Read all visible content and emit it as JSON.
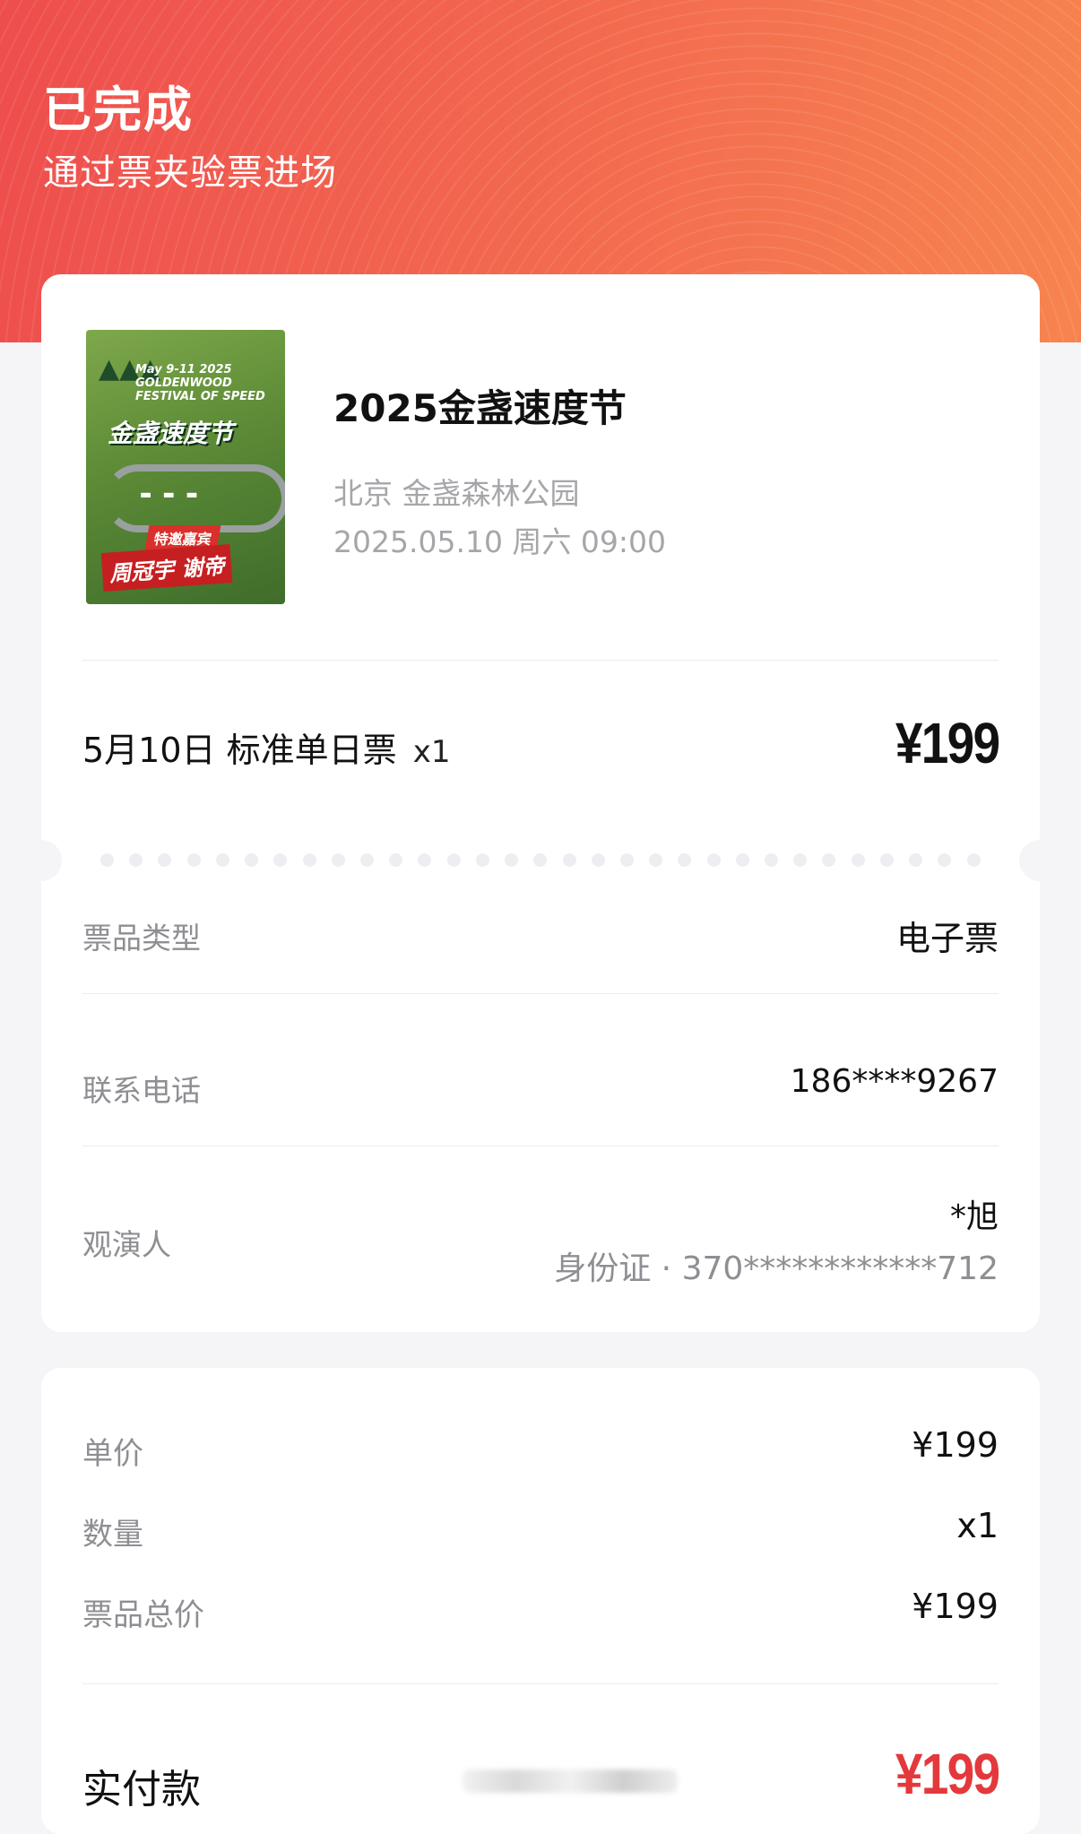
{
  "header": {
    "status": "已完成",
    "subtitle": "通过票夹验票进场"
  },
  "event": {
    "poster": {
      "brand_lines": [
        "May 9-11 2025",
        "GOLDENWOOD",
        "FESTIVAL OF SPEED"
      ],
      "title": "金盏速度节",
      "guest_tag": "特邀嘉宾",
      "guest_names": "周冠宇 谢帝"
    },
    "name": "2025金盏速度节",
    "location": "北京 金盏森林公园",
    "datetime": "2025.05.10 周六 09:00"
  },
  "ticket": {
    "description": "5月10日 标准单日票",
    "quantity": "x1",
    "price": "¥199"
  },
  "details": {
    "type_label": "票品类型",
    "type_value": "电子票",
    "phone_label": "联系电话",
    "phone_value": "186****9267",
    "attendee_label": "观演人",
    "attendee_name": "*旭",
    "attendee_id": "身份证 · 370************712"
  },
  "price_summary": {
    "unit_label": "单价",
    "unit_value": "¥199",
    "qty_label": "数量",
    "qty_value": "x1",
    "total_label": "票品总价",
    "total_value": "¥199",
    "paid_label": "实付款",
    "paid_value": "¥199"
  },
  "colors": {
    "header_start": "#ee4d4d",
    "header_end": "#f7844f",
    "paid_accent": "#e4393c"
  }
}
